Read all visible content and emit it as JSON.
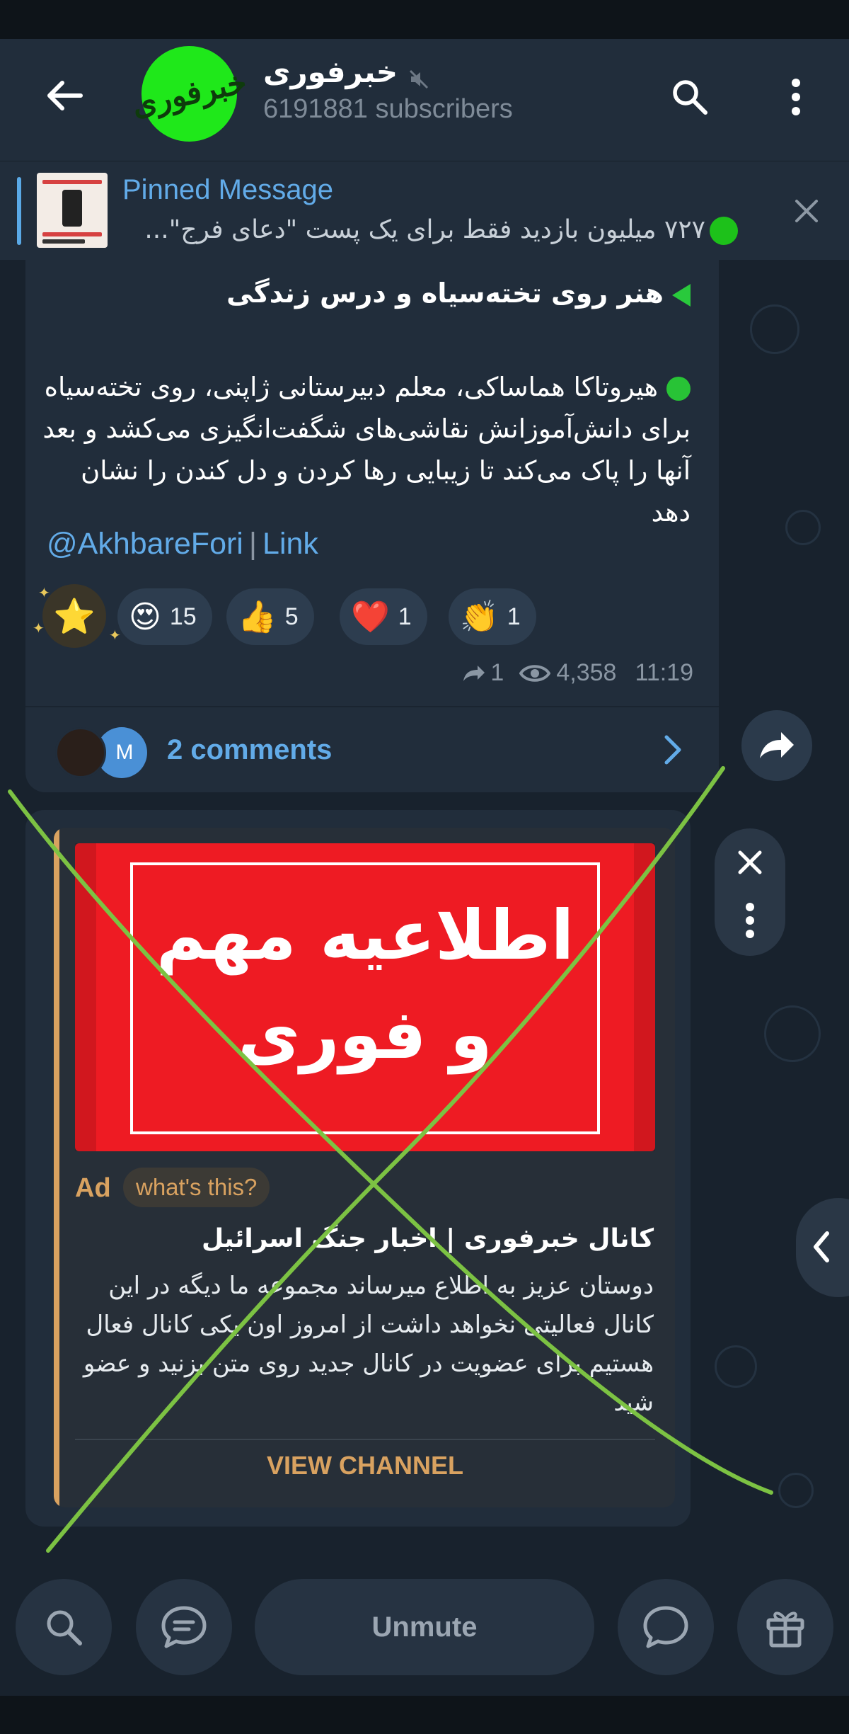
{
  "header": {
    "channel_name": "خبرفوری",
    "subscribers": "6191881 subscribers",
    "avatar_text": "خبرفوری"
  },
  "pinned": {
    "title": "Pinned Message",
    "text": "۷۲۷ میلیون بازدید فقط برای یک پست \"دعای فرج\"..."
  },
  "message": {
    "title": "هنر روی تخته‌سیاه و درس زندگی",
    "body": "هیروتاکا هماساکی، معلم دبیرستانی ژاپنی، روی تخته‌سیاه برای دانش‌آموزانش نقاشی‌های شگفت‌انگیزی می‌کشد و بعد آنها را پاک می‌کند تا زیبایی رها کردن و دل کندن را نشان دهد",
    "handle": "@AkhbareFori",
    "separator": "|",
    "link_label": "Link",
    "reactions": [
      {
        "emoji": "😍",
        "count": "15"
      },
      {
        "emoji": "👍",
        "count": "5"
      },
      {
        "emoji": "❤️",
        "count": "1"
      },
      {
        "emoji": "👏",
        "count": "1"
      }
    ],
    "star_reaction": "⭐",
    "forwards": "1",
    "views": "4,358",
    "time": "11:19",
    "comments": "2 comments",
    "commenter_initial": "M"
  },
  "ad": {
    "banner_line1": "اطلاعیه مهم",
    "banner_line2": "و فوری",
    "label": "Ad",
    "whats_this": "what's this?",
    "title": "کانال خبرفوری | اخبار جنگ اسرائیل",
    "body": "دوستان عزیز به اطلاع میرساند مجموعه ما دیگه در این کانال فعالیتی نخواهد داشت از امروز اون یکی کانال فعال هستیم برای عضویت در کانال جدید روی متن بزنید و عضو شید",
    "cta": "VIEW CHANNEL"
  },
  "bottom": {
    "unmute": "Unmute"
  },
  "colors": {
    "accent_blue": "#62abe8",
    "ad_gold": "#d9a260",
    "overlay_green": "#7cc243",
    "avatar_green": "#1fe81a"
  }
}
